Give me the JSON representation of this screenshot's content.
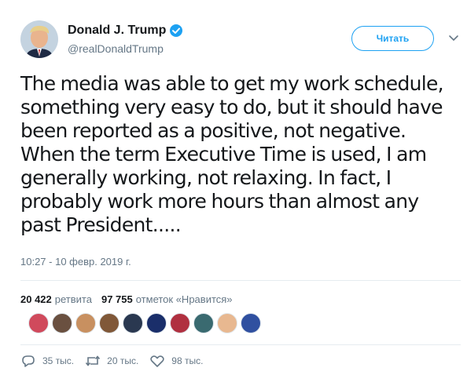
{
  "author": {
    "display_name": "Donald J. Trump",
    "handle": "@realDonaldTrump",
    "verified": true
  },
  "follow_button_label": "Читать",
  "tweet_text": "The media was able to get my work schedule,\nsomething very easy to do, but it should have\nbeen reported as a positive, not negative.\nWhen the term Executive Time is used, I am\ngenerally working, not relaxing. In fact, I\nprobably work more hours than almost any\npast President.....",
  "timestamp": "10:27 - 10 февр. 2019 г.",
  "stats": {
    "retweets_count": "20 422",
    "retweets_label": "ретвита",
    "likes_count": "97 755",
    "likes_label": "отметок «Нравится»"
  },
  "liker_avatars": [
    "#d04a5c",
    "#6a5040",
    "#c89060",
    "#805838",
    "#2a3850",
    "#1a2e6a",
    "#b03040",
    "#3a6a70",
    "#e8b890",
    "#3050a0"
  ],
  "actions": {
    "replies": "35 тыс.",
    "retweets": "20 тыс.",
    "likes": "98 тыс."
  },
  "colors": {
    "accent": "#1da1f2",
    "secondary_text": "#657786",
    "primary_text": "#14171a"
  }
}
